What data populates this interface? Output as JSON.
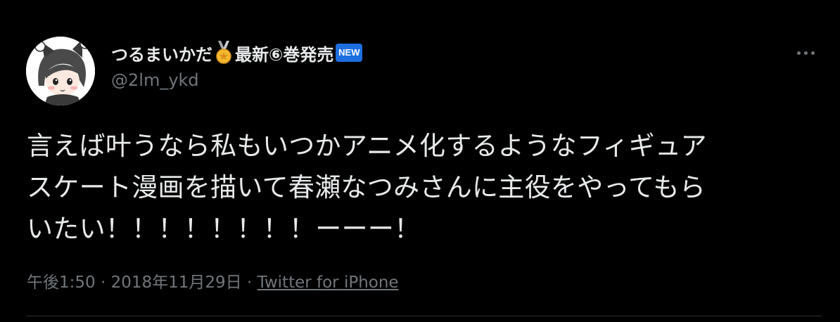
{
  "colors": {
    "background": "#000000",
    "primary_text": "#e7e9ea",
    "secondary_text": "#71767b",
    "divider": "#2f3336",
    "new_badge": "#1d6fe0"
  },
  "author": {
    "display_name": "つるまいかだ",
    "name_suffix": "最新⑥巻発売",
    "badge_icon": "medal-icon",
    "new_badge": "NEW",
    "handle": "@2lm_ykd"
  },
  "tweet": {
    "lines": [
      "言えば叶うなら私もいつかアニメ化するようなフィギュア",
      "スケート漫画を描いて春瀬なつみさんに主役をやってもら",
      "いたい！！！！！！！！ーーー！"
    ]
  },
  "meta": {
    "time": "午後1:50",
    "separator1": " · ",
    "date": "2018年11月29日",
    "separator2": " · ",
    "source": "Twitter for iPhone"
  },
  "icons": {
    "more": "more-icon",
    "avatar": "avatar-icon"
  }
}
